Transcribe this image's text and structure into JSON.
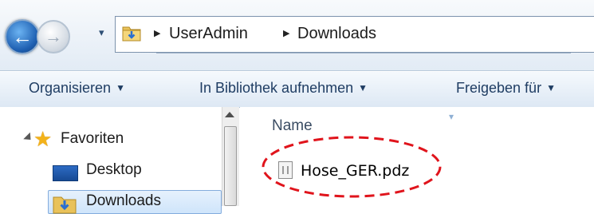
{
  "address_bar": {
    "breadcrumbs": [
      "UserAdmin",
      "Downloads"
    ],
    "separator": "▶"
  },
  "navigation": {
    "back_glyph": "←",
    "forward_glyph": "→",
    "history_caret": "▾"
  },
  "toolbar": {
    "buttons": [
      "Organisieren",
      "In Bibliothek aufnehmen",
      "Freigeben für"
    ],
    "caret": "▼"
  },
  "nav_pane": {
    "favorites_label": "Favoriten",
    "items": [
      "Desktop",
      "Downloads"
    ]
  },
  "file_list": {
    "column_name": "Name",
    "files": [
      {
        "name": "Hose_GER.pdz",
        "icon": "generic-file-icon",
        "highlighted": true
      }
    ]
  },
  "colors": {
    "highlight": "#e0141c",
    "accent": "#1e5fb1",
    "toolbar_text": "#1f3d63"
  }
}
